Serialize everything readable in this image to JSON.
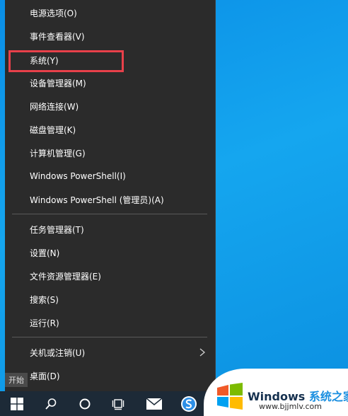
{
  "menu": {
    "items": [
      {
        "label": "电源选项(O)"
      },
      {
        "label": "事件查看器(V)"
      },
      {
        "label": "系统(Y)"
      },
      {
        "label": "设备管理器(M)"
      },
      {
        "label": "网络连接(W)"
      },
      {
        "label": "磁盘管理(K)"
      },
      {
        "label": "计算机管理(G)"
      },
      {
        "label": "Windows PowerShell(I)"
      },
      {
        "label": "Windows PowerShell (管理员)(A)"
      },
      {
        "label": "任务管理器(T)"
      },
      {
        "label": "设置(N)"
      },
      {
        "label": "文件资源管理器(E)"
      },
      {
        "label": "搜索(S)"
      },
      {
        "label": "运行(R)"
      },
      {
        "label": "关机或注销(U)"
      },
      {
        "label": "桌面(D)"
      }
    ],
    "highlight_color": "#e8404a",
    "background": "#2b2b2b"
  },
  "start_tooltip": "开始",
  "taskbar": {
    "icons": [
      "windows-start-icon",
      "search-icon",
      "cortana-icon",
      "task-view-icon",
      "mail-icon",
      "sogou-browser-icon"
    ]
  },
  "watermark": {
    "title_prefix": "Windows ",
    "title_accent": "系统之家",
    "url": "www.bjjmlv.com"
  }
}
